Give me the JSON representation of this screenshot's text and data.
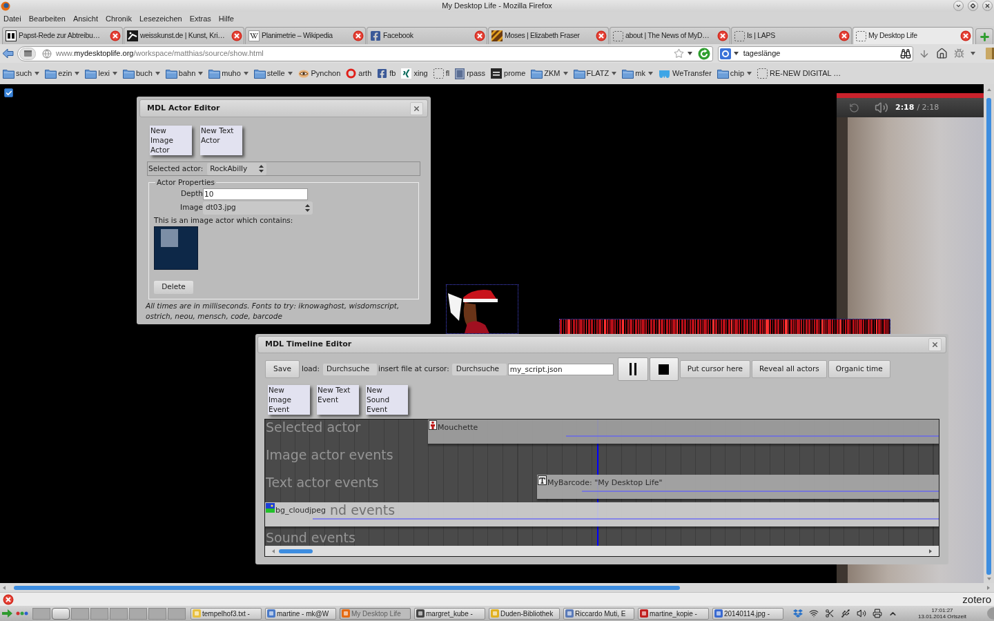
{
  "window": {
    "title": "My Desktop Life - Mozilla Firefox"
  },
  "menu": [
    "Datei",
    "Bearbeiten",
    "Ansicht",
    "Chronik",
    "Lesezeichen",
    "Extras",
    "Hilfe"
  ],
  "tabs": [
    {
      "label": "Papst-Rede zur Abtreibu…",
      "selected": false
    },
    {
      "label": "weisskunst.de | Kunst, Kri…",
      "selected": false
    },
    {
      "label": "Planimetrie – Wikipedia",
      "selected": false
    },
    {
      "label": "Facebook",
      "selected": false
    },
    {
      "label": "Moses | Elizabeth Fraser",
      "selected": false
    },
    {
      "label": "about | The News of MyD…",
      "selected": false
    },
    {
      "label": "Is | LAPS",
      "selected": false
    },
    {
      "label": "My Desktop Life",
      "selected": true
    }
  ],
  "navigation": {
    "url": "www.**mydesktoplife.org**/workspace/matthias/source/show.html",
    "search": "tageslänge"
  },
  "bookmarks": [
    {
      "kind": "folder",
      "label": "such"
    },
    {
      "kind": "folder",
      "label": "ezin"
    },
    {
      "kind": "folder",
      "label": "lexi"
    },
    {
      "kind": "folder",
      "label": "buch"
    },
    {
      "kind": "folder",
      "label": "bahn"
    },
    {
      "kind": "folder",
      "label": "muho"
    },
    {
      "kind": "folder",
      "label": "stelle"
    },
    {
      "kind": "link",
      "label": "Pynchon"
    },
    {
      "kind": "link",
      "label": "arth"
    },
    {
      "kind": "link",
      "label": "fb"
    },
    {
      "kind": "link",
      "label": "xing"
    },
    {
      "kind": "link",
      "label": "fl"
    },
    {
      "kind": "link",
      "label": "rpass"
    },
    {
      "kind": "link",
      "label": "prome"
    },
    {
      "kind": "folder",
      "label": "ZKM"
    },
    {
      "kind": "folder",
      "label": "FLATZ"
    },
    {
      "kind": "folder",
      "label": "mk"
    },
    {
      "kind": "link",
      "label": "WeTransfer"
    },
    {
      "kind": "folder",
      "label": "chip"
    },
    {
      "kind": "link",
      "label": "RE-NEW DIGITAL …"
    }
  ],
  "page": {
    "checkbox": {
      "checked": true
    },
    "actor_editor": {
      "title": "MDL Actor Editor",
      "buttons": [
        "New Image Actor",
        "New Text Actor"
      ],
      "selected_actor_label": "Selected actor:",
      "selected_actor": "RockAbilly",
      "properties_title": "Actor Properties",
      "depth_label": "Depth",
      "depth": "10",
      "image_label": "Image",
      "image": "dt03.jpg",
      "contains_text": "This is an image actor which contains:",
      "delete_button": "Delete",
      "note": "All times are in milliseconds. Fonts to try: iknowaghost, wisdomscript, ostrich, neou, mensch, code, barcode"
    },
    "video": {
      "level": 1,
      "elapsed": "2:18",
      "duration": "/ 2:18"
    },
    "timeline_editor": {
      "title": "MDL Timeline Editor",
      "save_button": "Save",
      "load_label": "load:",
      "load_browse_button": "Durchsuche",
      "insert_label": "insert file at cursor:",
      "insert_browse_button": "Durchsuche",
      "file_name": "my_script.json",
      "actions": [
        "Put cursor here",
        "Reveal all actors",
        "Organic time"
      ],
      "event_buttons": [
        "New Image Event",
        "New Text Event",
        "New Sound Event"
      ],
      "tracks": [
        {
          "label": "Selected actor",
          "events": [
            {
              "kind": "actor",
              "label": "Mouchette"
            }
          ]
        },
        {
          "label": "Image actor events"
        },
        {
          "label": "Text actor events",
          "events": [
            {
              "kind": "text",
              "label": "MyBarcode: \"My Desktop Life\""
            }
          ]
        },
        {
          "label": "nd events",
          "events": [
            {
              "kind": "image",
              "label": "bg_cloudjpeg"
            }
          ]
        },
        {
          "label": "Sound events"
        }
      ]
    }
  },
  "addon_bar": {
    "label": "zotero"
  },
  "taskbar": {
    "desktops": [
      {
        "selected": false
      },
      {
        "selected": true
      },
      {
        "selected": false
      },
      {
        "selected": false
      },
      {
        "selected": false
      },
      {
        "selected": false
      },
      {
        "selected": false
      },
      {
        "selected": false
      }
    ],
    "tasks": [
      {
        "label": "tempelhof3.txt -",
        "selected": false
      },
      {
        "label": "martine - mk@W",
        "selected": false
      },
      {
        "label": "My Desktop Life",
        "selected": true
      },
      {
        "label": "margret_kube -",
        "selected": false
      },
      {
        "label": "Duden-Bibliothek",
        "selected": false
      },
      {
        "label": "Riccardo Muti, E",
        "selected": false
      },
      {
        "label": "martine_kopie -",
        "selected": false
      },
      {
        "label": "20140114.jpg -",
        "selected": false
      }
    ],
    "clock": {
      "time": "17:01:27",
      "date": "13.01.2014 Ortszeit"
    }
  }
}
